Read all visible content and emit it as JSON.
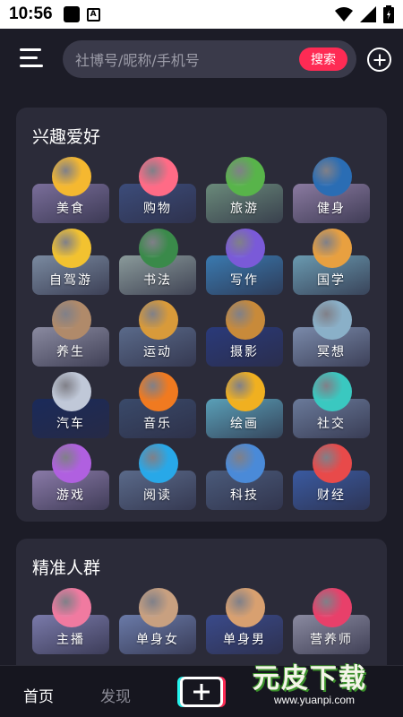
{
  "status_bar": {
    "time": "10:56",
    "a_badge": "A"
  },
  "header": {
    "search_placeholder": "社博号/昵称/手机号",
    "search_button": "搜索"
  },
  "interests": {
    "title": "兴趣爱好",
    "items": [
      {
        "label": "美食",
        "icon": "food-icon",
        "icon_color": "#f5b830",
        "bg": "#7a6e9a"
      },
      {
        "label": "购物",
        "icon": "shopping-bag-icon",
        "icon_color": "#ff6b86",
        "bg": "#3c4c7a"
      },
      {
        "label": "旅游",
        "icon": "travel-icon",
        "icon_color": "#58b44a",
        "bg": "#6a8a7a"
      },
      {
        "label": "健身",
        "icon": "fitness-icon",
        "icon_color": "#2a6db4",
        "bg": "#8a7aa0"
      },
      {
        "label": "自驾游",
        "icon": "car-trip-icon",
        "icon_color": "#f2c230",
        "bg": "#7a8aa0"
      },
      {
        "label": "书法",
        "icon": "calligraphy-icon",
        "icon_color": "#3a8a4a",
        "bg": "#8a9a9a"
      },
      {
        "label": "写作",
        "icon": "writing-icon",
        "icon_color": "#7a5ad8",
        "bg": "#3a7ab0"
      },
      {
        "label": "国学",
        "icon": "sinology-icon",
        "icon_color": "#e8a040",
        "bg": "#6a9ab0"
      },
      {
        "label": "养生",
        "icon": "health-icon",
        "icon_color": "#b08a6a",
        "bg": "#8a8aa0"
      },
      {
        "label": "运动",
        "icon": "sport-icon",
        "icon_color": "#d89a3a",
        "bg": "#5a6a8a"
      },
      {
        "label": "摄影",
        "icon": "camera-icon",
        "icon_color": "#c88a3a",
        "bg": "#2a3a7a"
      },
      {
        "label": "冥想",
        "icon": "meditation-icon",
        "icon_color": "#8ab0c8",
        "bg": "#7a8aaa"
      },
      {
        "label": "汽车",
        "icon": "car-icon",
        "icon_color": "#c0c8d8",
        "bg": "#1a2a5a"
      },
      {
        "label": "音乐",
        "icon": "music-icon",
        "icon_color": "#f07a20",
        "bg": "#3a4a6a"
      },
      {
        "label": "绘画",
        "icon": "painting-icon",
        "icon_color": "#f0b020",
        "bg": "#5aa0b8"
      },
      {
        "label": "社交",
        "icon": "social-icon",
        "icon_color": "#3ac8c0",
        "bg": "#6a7a9a"
      },
      {
        "label": "游戏",
        "icon": "gamepad-icon",
        "icon_color": "#b060e0",
        "bg": "#8a7aa8"
      },
      {
        "label": "阅读",
        "icon": "reading-icon",
        "icon_color": "#28a8e8",
        "bg": "#5a6a8a"
      },
      {
        "label": "科技",
        "icon": "tech-ai-icon",
        "icon_color": "#4a8ad8",
        "bg": "#4a5a7a"
      },
      {
        "label": "财经",
        "icon": "finance-icon",
        "icon_color": "#e84a4a",
        "bg": "#3a5aa0"
      }
    ]
  },
  "audience": {
    "title": "精准人群",
    "items": [
      {
        "label": "主播",
        "icon": "streamer-icon",
        "icon_color": "#f07aa0",
        "bg": "#7a7aaa"
      },
      {
        "label": "单身女",
        "icon": "single-woman-icon",
        "icon_color": "#c8a080",
        "bg": "#6a7aa8"
      },
      {
        "label": "单身男",
        "icon": "single-man-icon",
        "icon_color": "#d8a070",
        "bg": "#3a4a8a"
      },
      {
        "label": "营养师",
        "icon": "nutritionist-icon",
        "icon_color": "#e8406a",
        "bg": "#8a8aa0"
      }
    ]
  },
  "bottom_nav": {
    "home": "首页",
    "discover": "发现"
  },
  "watermark": {
    "title": "元皮下载",
    "url": "www.yuanpi.com"
  }
}
